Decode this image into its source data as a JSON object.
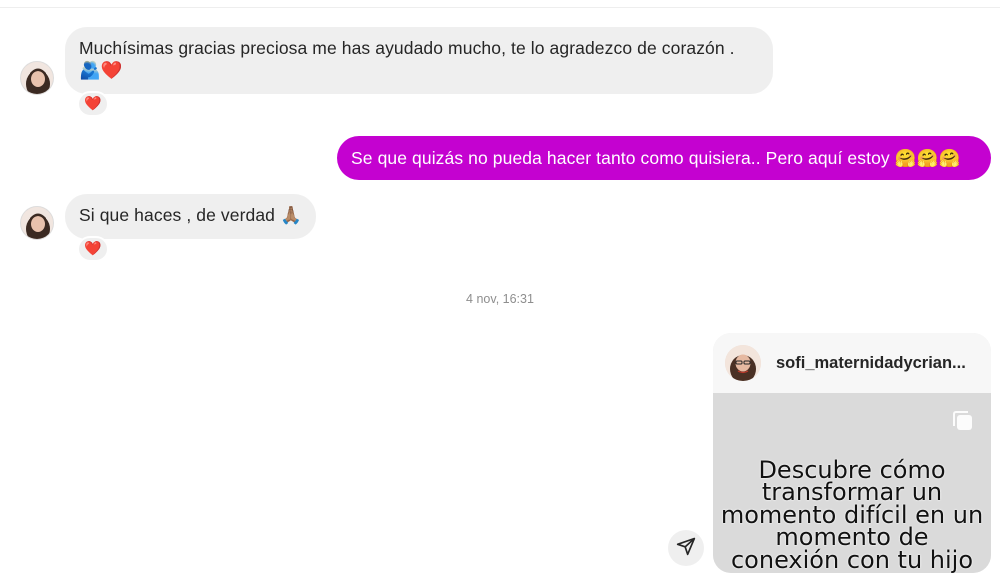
{
  "conversation": {
    "messages": [
      {
        "direction": "incoming",
        "text_line1": "Muchísimas gracias preciosa me has ayudado mucho, te lo agradezco de corazón .",
        "text_line2": "🫂❤️",
        "reaction": "❤️"
      },
      {
        "direction": "outgoing",
        "text": "Se que quizás no pueda hacer tanto como quisiera.. Pero aquí estoy 🤗🤗🤗"
      },
      {
        "direction": "incoming",
        "text": "Si que haces , de verdad 🙏🏽",
        "reaction": "❤️"
      }
    ],
    "timestamp": "4 nov, 16:31",
    "shared_post": {
      "username": "sofi_maternidadycrian...",
      "caption": "Descubre cómo transformar un momento difícil en un momento de conexión con tu hijo"
    }
  },
  "icons": {
    "share": "send-icon",
    "multiple_images": "carousel-icon"
  },
  "colors": {
    "outgoing_bubble": "#c402d0",
    "incoming_bubble": "#efefef"
  }
}
